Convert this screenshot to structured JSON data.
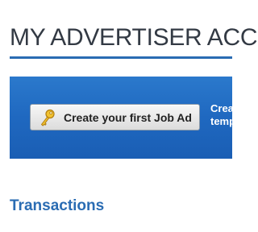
{
  "page": {
    "title": "MY ADVERTISER ACC"
  },
  "banner": {
    "create_button_label": "Create your first Job Ad",
    "side_text_line1": "Creat",
    "side_text_line2": "templ",
    "background_color": "#1f68c0"
  },
  "icons": {
    "create_button_icon": "key-icon"
  },
  "sections": {
    "transactions_title": "Transactions"
  },
  "colors": {
    "accent": "#2a6cb3",
    "title_text": "#333a44"
  }
}
